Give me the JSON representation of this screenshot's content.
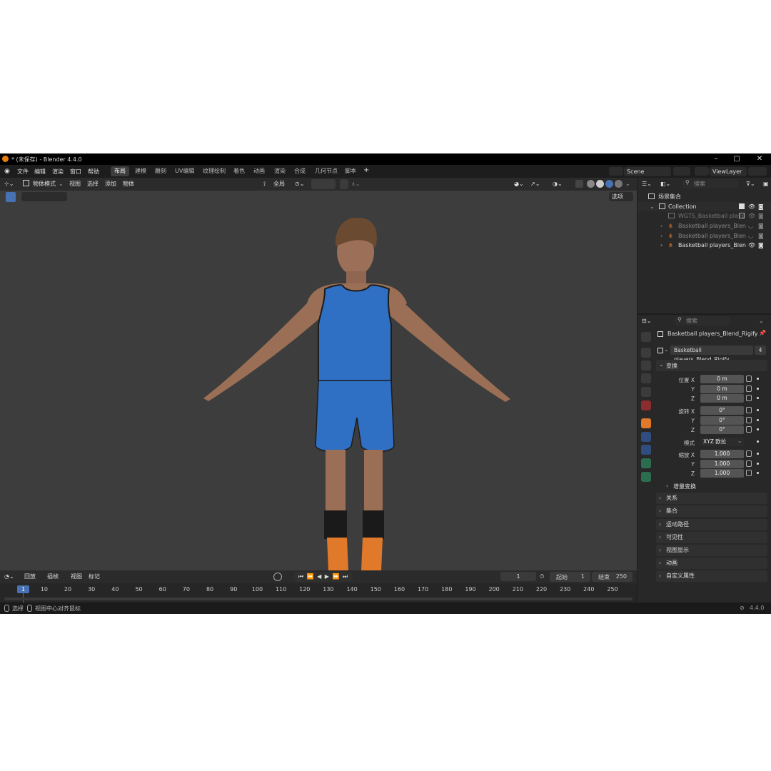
{
  "window": {
    "title": "* (未保存) - Blender 4.4.0"
  },
  "menu": {
    "items": [
      "文件",
      "编辑",
      "渲染",
      "窗口",
      "帮助"
    ]
  },
  "workspaces": [
    "布局",
    "建模",
    "雕刻",
    "UV编辑",
    "纹理绘制",
    "着色",
    "动画",
    "渲染",
    "合成",
    "几何节点",
    "脚本"
  ],
  "scene": {
    "name": "Scene",
    "view_layer": "ViewLayer"
  },
  "viewport_header": {
    "mode": "物体模式",
    "menus": [
      "视图",
      "选择",
      "添加",
      "物体"
    ],
    "transform_orientation": "全局",
    "options_label": "选项"
  },
  "outliner": {
    "search_placeholder": "搜索",
    "root": "场景集合",
    "collection": "Collection",
    "items": [
      "WGTS_Basketball playe",
      "Basketball players_Blen",
      "Basketball players_Blen",
      "Basketball players_Blen"
    ]
  },
  "properties": {
    "search_placeholder": "搜索",
    "object_name": "Basketball players_Blend_Rigify",
    "data_name": "Basketball players_Blend_Rigify",
    "users": "4",
    "transform_title": "变换",
    "location_label": "位置 X",
    "rotation_label": "旋转 X",
    "scale_label": "缩放 X",
    "mode_label": "模式",
    "mode_value": "XYZ 欧拉",
    "axis_y": "Y",
    "axis_z": "Z",
    "location": [
      "0 m",
      "0 m",
      "0 m"
    ],
    "rotation": [
      "0°",
      "0°",
      "0°"
    ],
    "scale": [
      "1.000",
      "1.000",
      "1.000"
    ],
    "delta_transform": "增量变换",
    "sections": [
      "关系",
      "集合",
      "运动路径",
      "可见性",
      "视图显示",
      "动画",
      "自定义属性"
    ]
  },
  "timeline_header": {
    "menus": [
      "回放",
      "插帧",
      "视图",
      "标记"
    ],
    "current_frame": "1",
    "start_label": "起始",
    "start": "1",
    "end_label": "结束",
    "end": "250"
  },
  "timeline": {
    "current_frame": "1",
    "ticks": [
      "10",
      "20",
      "30",
      "40",
      "50",
      "60",
      "70",
      "80",
      "90",
      "100",
      "110",
      "120",
      "130",
      "140",
      "150",
      "160",
      "170",
      "180",
      "190",
      "200",
      "210",
      "220",
      "230",
      "240",
      "250"
    ]
  },
  "statusbar": {
    "select": "选择",
    "center": "视图中心对齐鼠标",
    "version": "4.4.0"
  },
  "colors": {
    "jersey": "#2f6fc4",
    "accent": "#4772b3",
    "active_frame": "#4772b3",
    "object_orange": "#e0792a"
  }
}
